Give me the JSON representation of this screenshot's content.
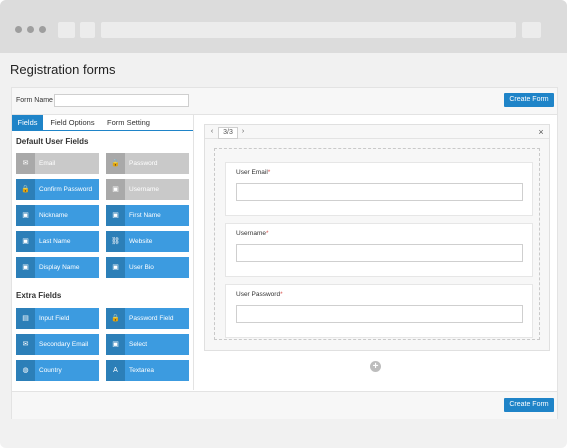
{
  "page": {
    "title": "Registration forms"
  },
  "form_name": {
    "label": "Form Name",
    "value": ""
  },
  "buttons": {
    "create_form_top": "Create Form",
    "create_form_bottom": "Create Form"
  },
  "tabs": [
    {
      "label": "Fields",
      "active": true
    },
    {
      "label": "Field Options",
      "active": false
    },
    {
      "label": "Form Setting",
      "active": false
    }
  ],
  "sections": {
    "default_title": "Default User Fields",
    "extra_title": "Extra Fields"
  },
  "default_fields": [
    {
      "label": "Email",
      "icon": "envelope-icon",
      "glyph": "✉",
      "disabled": true
    },
    {
      "label": "Password",
      "icon": "lock-icon",
      "glyph": "🔒",
      "disabled": true
    },
    {
      "label": "Confirm Password",
      "icon": "lock-icon",
      "glyph": "🔒",
      "disabled": false
    },
    {
      "label": "Username",
      "icon": "id-card-icon",
      "glyph": "▣",
      "disabled": true
    },
    {
      "label": "Nickname",
      "icon": "id-card-icon",
      "glyph": "▣",
      "disabled": false
    },
    {
      "label": "First Name",
      "icon": "id-card-icon",
      "glyph": "▣",
      "disabled": false
    },
    {
      "label": "Last Name",
      "icon": "id-card-icon",
      "glyph": "▣",
      "disabled": false
    },
    {
      "label": "Website",
      "icon": "link-icon",
      "glyph": "⛓",
      "disabled": false
    },
    {
      "label": "Display Name",
      "icon": "id-card-icon",
      "glyph": "▣",
      "disabled": false
    },
    {
      "label": "User Bio",
      "icon": "id-card-icon",
      "glyph": "▣",
      "disabled": false
    }
  ],
  "extra_fields": [
    {
      "label": "Input Field",
      "icon": "document-icon",
      "glyph": "▤"
    },
    {
      "label": "Password Field",
      "icon": "lock-icon",
      "glyph": "🔒"
    },
    {
      "label": "Secondary Email",
      "icon": "envelope-icon",
      "glyph": "✉"
    },
    {
      "label": "Select",
      "icon": "id-card-icon",
      "glyph": "▣"
    },
    {
      "label": "Country",
      "icon": "globe-icon",
      "glyph": "◍"
    },
    {
      "label": "Textarea",
      "icon": "text-icon",
      "glyph": "A"
    }
  ],
  "canvas": {
    "page_indicator": "3/3",
    "prev": "‹",
    "next": "›",
    "close": "×",
    "fields": [
      {
        "label": "User Email",
        "required": "*"
      },
      {
        "label": "Username",
        "required": "*"
      },
      {
        "label": "User Password",
        "required": "*"
      }
    ],
    "add": "+"
  }
}
